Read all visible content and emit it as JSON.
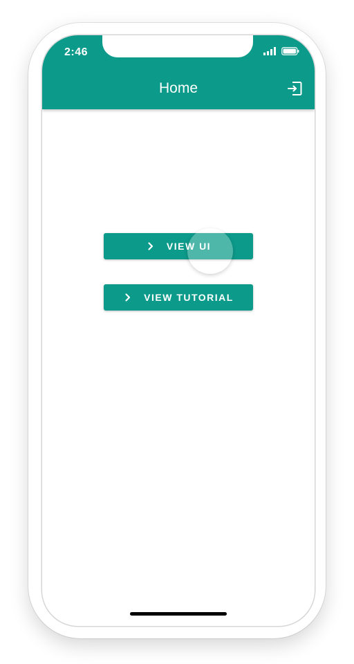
{
  "status_bar": {
    "time": "2:46"
  },
  "header": {
    "title": "Home",
    "logout_icon": "logout-icon"
  },
  "buttons": {
    "view_ui_label": "VIEW UI",
    "view_tutorial_label": "VIEW TUTORIAL",
    "icon": "chevron-right-icon"
  },
  "colors": {
    "primary": "#0c9a8a",
    "text_on_primary": "#ffffff",
    "background": "#ffffff"
  }
}
